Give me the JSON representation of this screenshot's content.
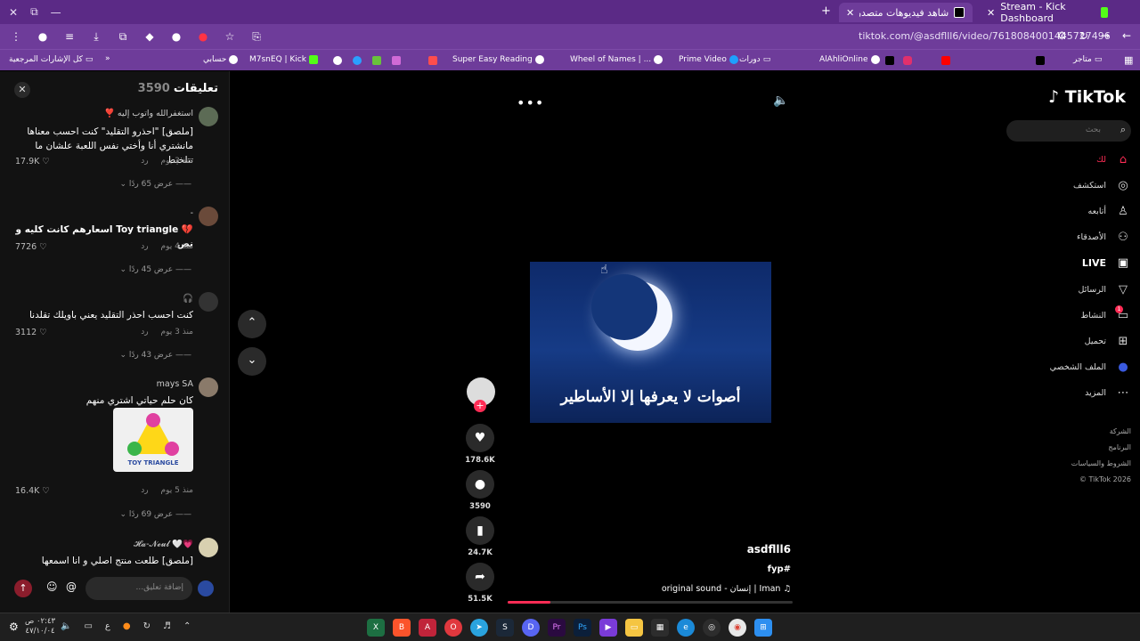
{
  "tabs": [
    {
      "title": "شاهد فيديوهات متصدرة | ...",
      "active": true
    },
    {
      "title": "Stream - Kick Dashboard",
      "active": false
    }
  ],
  "address": {
    "url": "tiktok.com/@asdflll6/video/7618084001445727496"
  },
  "bookmarks": [
    {
      "label": "كل الإشارات المرجعية"
    },
    {
      "label": "حسابي"
    },
    {
      "label": "M7snEQ | Kick"
    },
    {
      "label": "Super Easy Reading"
    },
    {
      "label": "Wheel of Names | ..."
    },
    {
      "label": "Prime Video"
    },
    {
      "label": "دورات"
    },
    {
      "label": "AlAhliOnline"
    },
    {
      "label": "متاجر"
    }
  ],
  "comments_panel": {
    "title": "تعليقات",
    "count": "3590",
    "input_placeholder": "إضافة تعليق...",
    "comments": [
      {
        "name": "استغفرالله واتوب إليه ❣️",
        "text": "[ملصق] \"احذرو التقليد\" كنت احسب معناها مانشتري أنا وأختي نفس اللعبة علشان ما تتلخبط",
        "time": "منذ 3 يوم",
        "reply": "رد",
        "likes": "17.9K",
        "replies": "عرض 65 ردًا"
      },
      {
        "name": "-",
        "text": "💔 Toy triangle اسعارهم كانت كليه و نص",
        "time": "منذ 4 يوم",
        "reply": "رد",
        "likes": "7726",
        "replies": "عرض 45 ردًا"
      },
      {
        "name": "🎧",
        "text": "كنت احسب احذر التقليد يعني باويلك تقلدنا",
        "time": "منذ 3 يوم",
        "reply": "رد",
        "likes": "3112",
        "replies": "عرض 43 ردًا"
      },
      {
        "name": "mays SA",
        "text": "كان حلم حياتي اشتري منهم",
        "time": "منذ 5 يوم",
        "reply": "رد",
        "likes": "16.4K",
        "replies": "عرض 69 ردًا",
        "sticker_text": "TOY TRIANGLE"
      },
      {
        "name": "💗🤍 𝓗𝓪-𝓝𝓮𝓾𝓵",
        "text": "[ملصق] طلعت منتج اصلي و انا اسمعها"
      }
    ]
  },
  "video": {
    "caption": "أصوات لا يعرفها إلا الأساطير",
    "author": "asdflll6",
    "tag": "fyp#",
    "sound": "original sound - إنسان | Iman",
    "progress": 0.15,
    "likes": "178.6K",
    "comments": "3590",
    "saves": "24.7K",
    "shares": "51.5K"
  },
  "sidebar": {
    "logo": "TikTok",
    "search_placeholder": "بحث",
    "nav": [
      {
        "label": "لك",
        "icon": "home-icon"
      },
      {
        "label": "استكشف",
        "icon": "compass-icon"
      },
      {
        "label": "أتابعه",
        "icon": "following-icon"
      },
      {
        "label": "الأصدقاء",
        "icon": "friends-icon"
      },
      {
        "label": "LIVE",
        "icon": "live-icon"
      },
      {
        "label": "الرسائل",
        "icon": "send-icon"
      },
      {
        "label": "النشاط",
        "icon": "activity-icon",
        "badge": "1"
      },
      {
        "label": "تحميل",
        "icon": "upload-icon"
      },
      {
        "label": "الملف الشخصي",
        "icon": "profile-icon"
      },
      {
        "label": "المزيد",
        "icon": "more-icon"
      }
    ],
    "footer": [
      "الشركة",
      "البرنامج",
      "الشروط والسياسات",
      "© TikTok 2026"
    ]
  },
  "taskbar": {
    "time": "٠٢:٤٣ ص",
    "date": "٤٧/١٠/٠٤",
    "lang": "ع"
  }
}
